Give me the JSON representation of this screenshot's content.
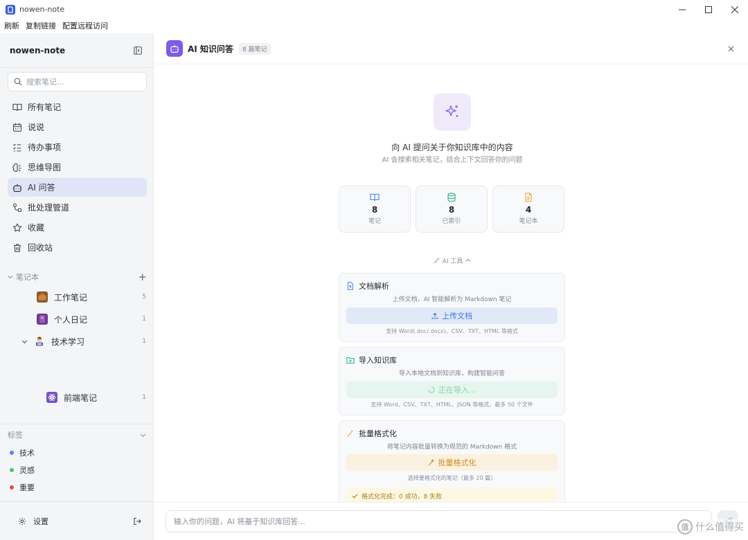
{
  "window": {
    "title": "nowen-note"
  },
  "menubar": {
    "items": [
      "刷新",
      "复制链接",
      "配置远程访问"
    ]
  },
  "sidebar": {
    "brand": "nowen-note",
    "search_placeholder": "搜索笔记...",
    "nav": [
      {
        "label": "所有笔记",
        "icon": "book-open-icon"
      },
      {
        "label": "说说",
        "icon": "calendar-icon"
      },
      {
        "label": "待办事项",
        "icon": "checklist-icon"
      },
      {
        "label": "思维导图",
        "icon": "brain-icon"
      },
      {
        "label": "AI 问答",
        "icon": "bot-icon",
        "active": true
      },
      {
        "label": "批处理管道",
        "icon": "workflow-icon"
      },
      {
        "label": "收藏",
        "icon": "star-icon"
      },
      {
        "label": "回收站",
        "icon": "trash-icon"
      }
    ],
    "notebooks_header": "笔记本",
    "notebooks": [
      {
        "name": "工作笔记",
        "count": "5",
        "icon": "briefcase-icon"
      },
      {
        "name": "个人日记",
        "count": "1",
        "icon": "diary-book-icon"
      },
      {
        "name": "技术学习",
        "count": "1",
        "icon": "technologist-icon",
        "expanded": true
      },
      {
        "name": "前端笔记",
        "count": "1",
        "icon": "react-atom-icon"
      }
    ],
    "tags_header": "标签",
    "tags": [
      {
        "name": "技术",
        "color": "#4c8df6"
      },
      {
        "name": "灵感",
        "color": "#4cc46a"
      },
      {
        "name": "重要",
        "color": "#ef4444"
      }
    ],
    "settings_label": "设置"
  },
  "main": {
    "title": "AI 知识问答",
    "count_badge": "8 篇笔记",
    "hero_title": "向 AI 提问关于你知识库中的内容",
    "hero_subtitle": "AI 会搜索相关笔记，结合上下文回答你的问题",
    "stats": [
      {
        "value": "8",
        "label": "笔记",
        "icon": "book-open-icon",
        "color": "#3b82f6"
      },
      {
        "value": "8",
        "label": "已索引",
        "icon": "database-icon",
        "color": "#22b07d"
      },
      {
        "value": "4",
        "label": "笔记本",
        "icon": "file-text-icon",
        "color": "#f2a33a"
      }
    ],
    "tools_toggle": "AI 工具",
    "tools": {
      "parse": {
        "title": "文档解析",
        "description": "上传文档，AI 智能解析为 Markdown 笔记",
        "button": "上传文档",
        "note": "支持 Word(.doc/.docx)、CSV、TXT、HTML 等格式"
      },
      "import": {
        "title": "导入知识库",
        "description": "导入本地文档到知识库，构建智能问答",
        "button": "正在导入...",
        "note": "支持 Word、CSV、TXT、HTML、JSON 等格式，最多 50 个文件"
      },
      "format": {
        "title": "批量格式化",
        "description": "将笔记内容批量转换为规范的 Markdown 格式",
        "button": "批量格式化",
        "note": "选择要格式化的笔记（最多 20 篇）",
        "result": "格式化完成：0 成功，8 失败"
      }
    },
    "input_placeholder": "输入你的问题，AI 将基于知识库回答..."
  },
  "watermark": {
    "text": "什么值得买",
    "logo_glyph": "值"
  },
  "colors": {
    "accent": "#7c5ce6",
    "active_nav_bg": "#dfe5f7",
    "upload_btn_bg": "#e1e9f8",
    "import_btn_bg": "#e6f5ee",
    "format_btn_bg": "#fbf1e0"
  }
}
